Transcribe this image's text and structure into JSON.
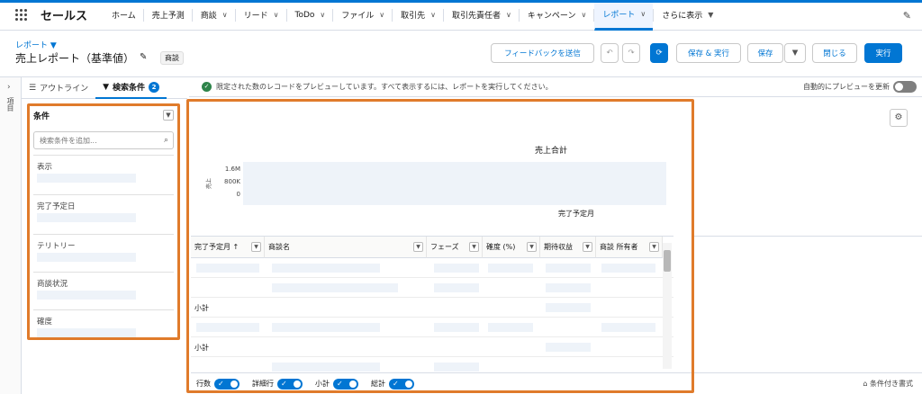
{
  "nav": {
    "app_name": "セールス",
    "items": [
      {
        "label": "ホーム",
        "chevron": false
      },
      {
        "label": "売上予測",
        "chevron": false
      },
      {
        "label": "商談",
        "chevron": true
      },
      {
        "label": "リード",
        "chevron": true
      },
      {
        "label": "ToDo",
        "chevron": true
      },
      {
        "label": "ファイル",
        "chevron": true
      },
      {
        "label": "取引先",
        "chevron": true
      },
      {
        "label": "取引先責任者",
        "chevron": true
      },
      {
        "label": "キャンペーン",
        "chevron": true
      },
      {
        "label": "レポート",
        "chevron": true,
        "active": true
      },
      {
        "label": "さらに表示",
        "chevron": true
      }
    ]
  },
  "header": {
    "report_type": "レポート ▼",
    "title": "売上レポート（基準値）",
    "badge": "商談",
    "buttons": {
      "feedback": "フィードバックを送信",
      "undo": "↶",
      "redo": "↷",
      "refresh": "⟳",
      "save_run": "保存 & 実行",
      "save": "保存",
      "save_menu": "▼",
      "close": "閉じる",
      "run": "実行"
    }
  },
  "sidebar": {
    "collapsed_label": "項目",
    "tabs": {
      "outline": "アウトライン",
      "filters": "検索条件",
      "filters_count": "2"
    }
  },
  "filters": {
    "heading": "条件",
    "search_placeholder": "検索条件を追加...",
    "items": [
      {
        "label": "表示"
      },
      {
        "label": "完了予定日"
      },
      {
        "label": "テリトリー"
      },
      {
        "label": "商談状況"
      },
      {
        "label": "確度"
      }
    ]
  },
  "preview": {
    "info": "限定された数のレコードをプレビューしています。すべて表示するには、レポートを実行してください。",
    "auto_label": "自動的にプレビューを更新"
  },
  "chart_data": {
    "type": "bar",
    "title": "売上合計",
    "xlabel": "完了予定月",
    "ylabel": "売上",
    "y_ticks": [
      "1.6M",
      "800K",
      "0"
    ],
    "ylim": [
      0,
      1600000
    ],
    "categories": [],
    "values": []
  },
  "table": {
    "columns": [
      {
        "label": "完了予定月 ↑",
        "x": 0,
        "w": 82
      },
      {
        "label": "商談名",
        "x": 82,
        "w": 180
      },
      {
        "label": "フェーズ",
        "x": 262,
        "w": 62
      },
      {
        "label": "確度 (%)",
        "x": 324,
        "w": 64
      },
      {
        "label": "期待収益",
        "x": 388,
        "w": 62
      },
      {
        "label": "商談 所有者",
        "x": 450,
        "w": 74
      }
    ],
    "subtotal_label": "小計"
  },
  "bottom": {
    "toggles": [
      {
        "label": "行数"
      },
      {
        "label": "詳細行"
      },
      {
        "label": "小計"
      },
      {
        "label": "総計"
      }
    ],
    "conditional_format": "条件付き書式"
  }
}
